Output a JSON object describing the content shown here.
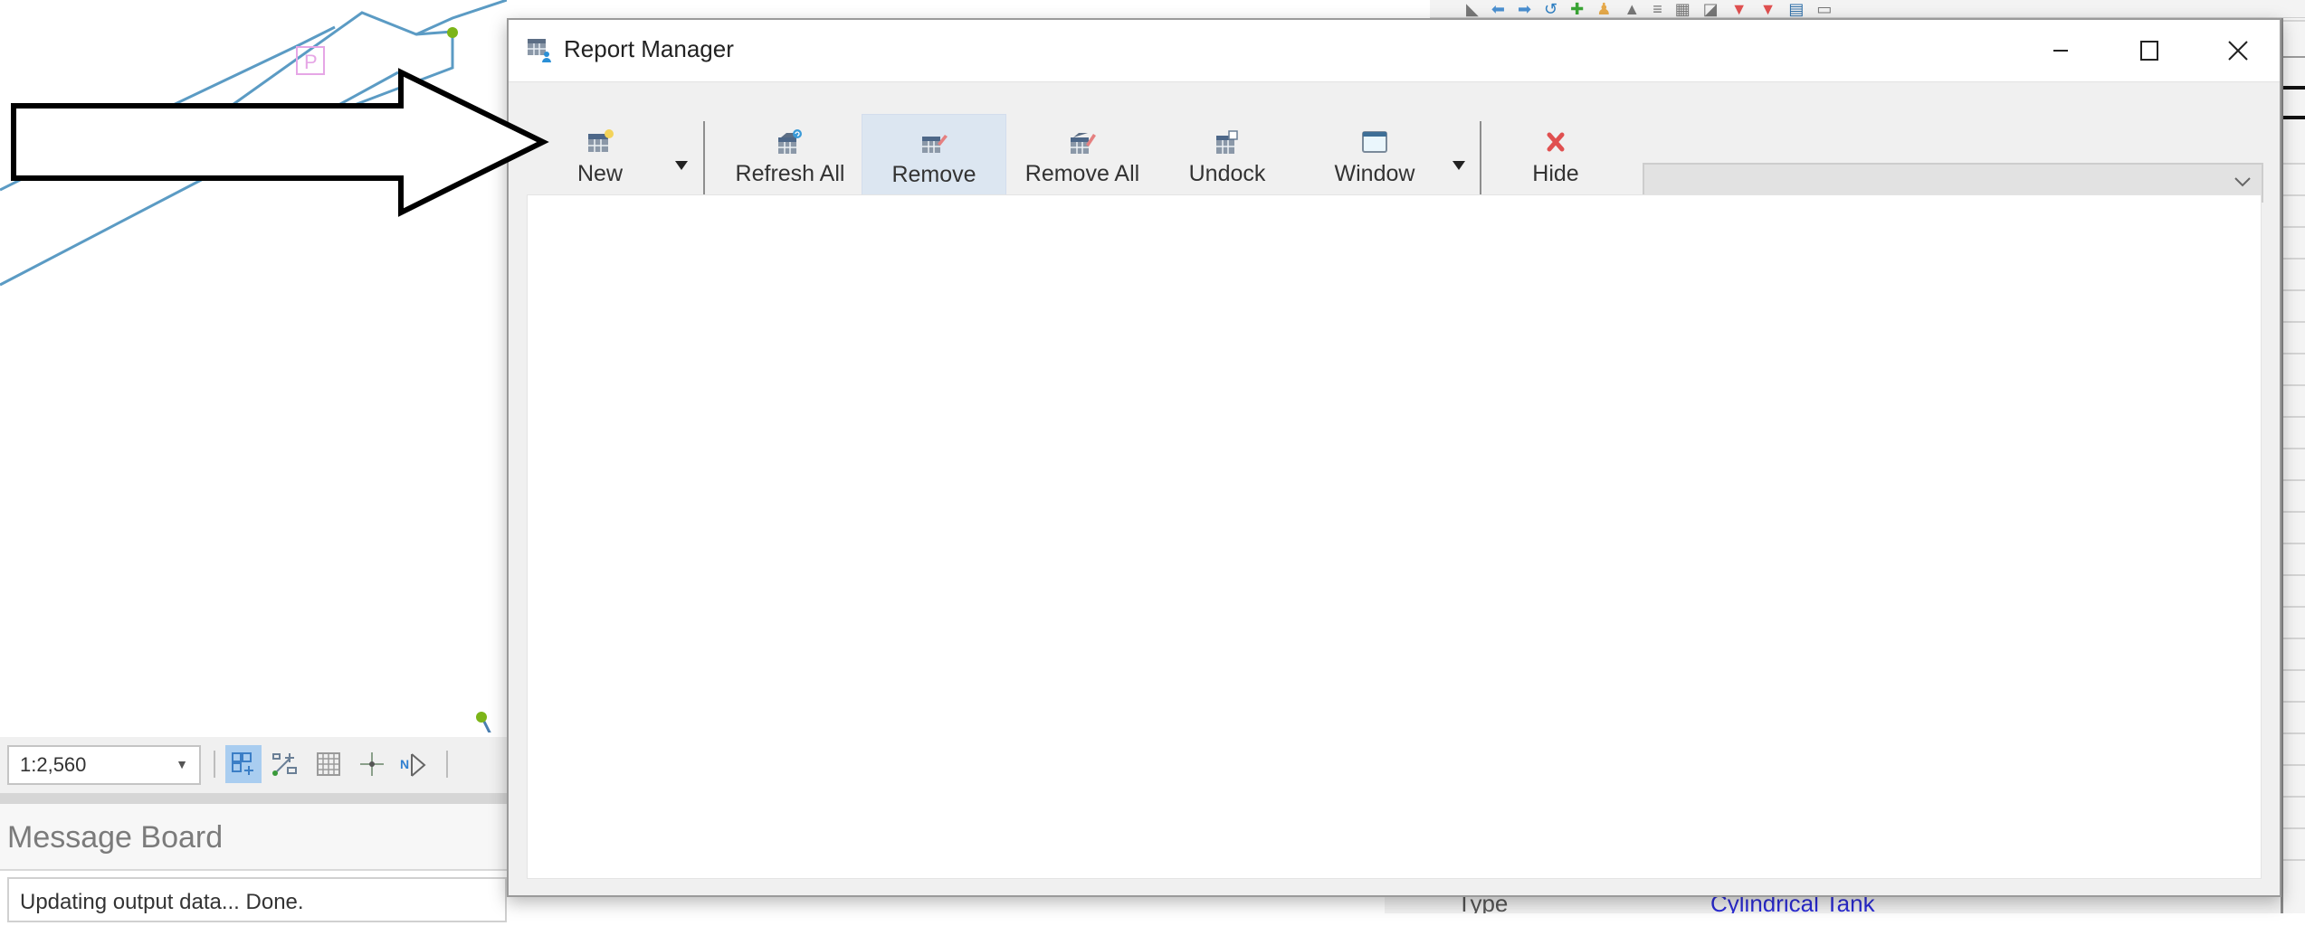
{
  "dialog": {
    "title": "Report Manager",
    "window_controls": {
      "minimize": "minimize",
      "maximize": "maximize",
      "close": "close"
    },
    "toolbar": {
      "new_label": "New",
      "refresh_all_label": "Refresh All",
      "remove_label": "Remove",
      "remove_all_label": "Remove All",
      "undock_label": "Undock",
      "window_label": "Window",
      "hide_label": "Hide",
      "highlighted_button": "Remove"
    },
    "report_select": {
      "value": ""
    },
    "content": {
      "empty": true
    }
  },
  "map": {
    "scale_value": "1:2,560",
    "label_marker": "P",
    "statusbar_icons": [
      "snapping-icon",
      "topology-icon",
      "grid-icon",
      "crosshair-icon",
      "north-arrow-icon"
    ]
  },
  "message_board": {
    "title": "Message Board",
    "message": "Updating output data... Done."
  },
  "attributes_panel": {
    "field_label": "Type",
    "field_value": "Cylindrical Tank"
  },
  "annotation": {
    "type": "arrow",
    "points_to": "New"
  },
  "colors": {
    "highlight": "#dce6f1",
    "hide_icon": "#e05050",
    "map_line": "#5b9bc4",
    "link_text": "#2b2bd6"
  }
}
